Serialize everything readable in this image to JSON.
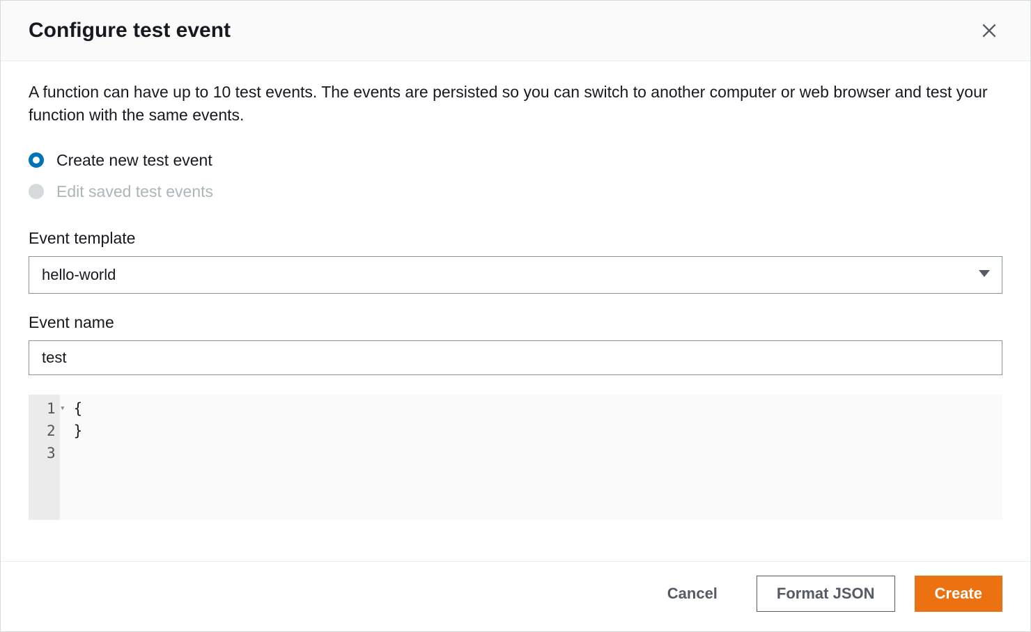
{
  "dialog": {
    "title": "Configure test event",
    "description": "A function can have up to 10 test events. The events are persisted so you can switch to another computer or web browser and test your function with the same events."
  },
  "radios": {
    "create_label": "Create new test event",
    "edit_label": "Edit saved test events"
  },
  "template_field": {
    "label": "Event template",
    "value": "hello-world"
  },
  "name_field": {
    "label": "Event name",
    "value": "test"
  },
  "code": {
    "lines": [
      {
        "num": "1",
        "text": "{",
        "fold": true
      },
      {
        "num": "2",
        "text": "",
        "active": true
      },
      {
        "num": "3",
        "text": "}"
      }
    ]
  },
  "footer": {
    "cancel": "Cancel",
    "format": "Format JSON",
    "create": "Create"
  }
}
